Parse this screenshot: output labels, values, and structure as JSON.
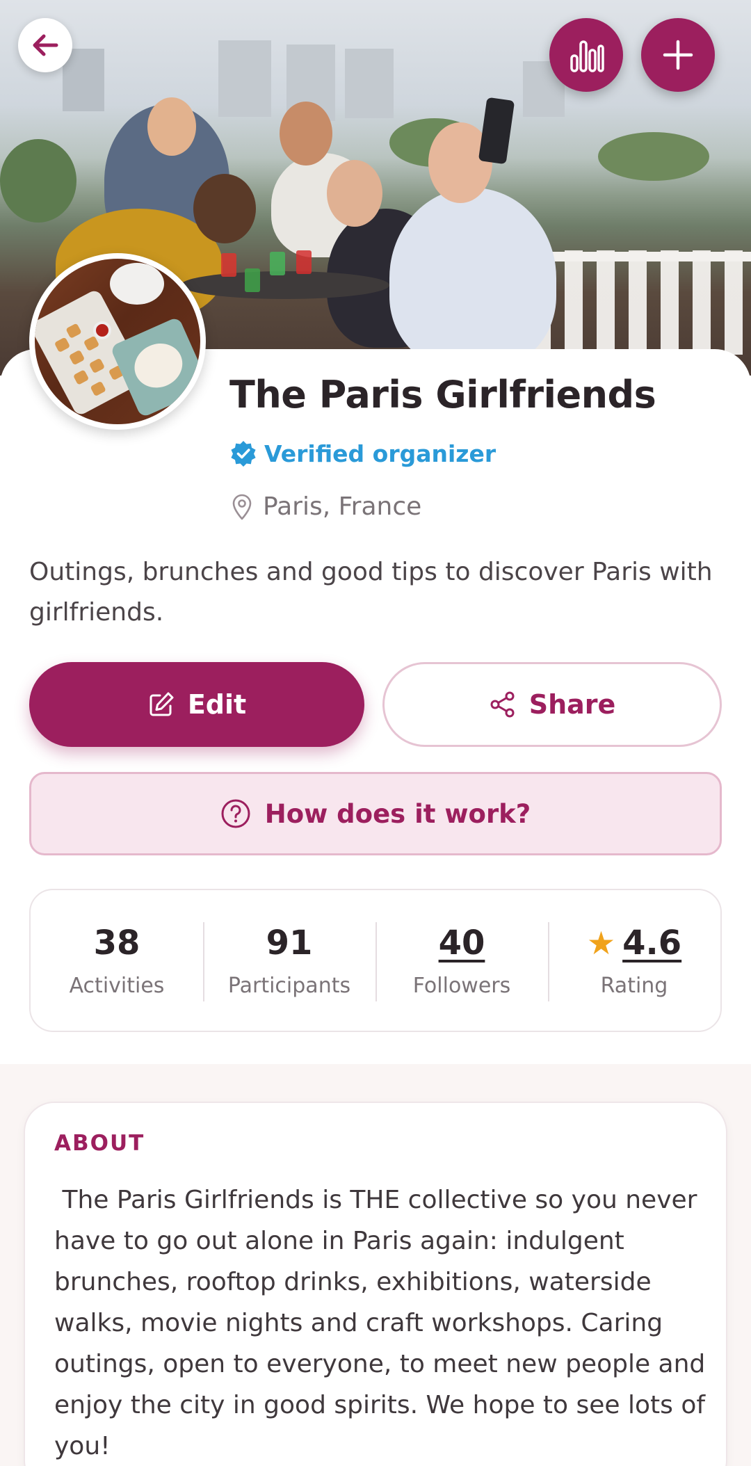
{
  "header": {
    "back_icon": "arrow-left-icon",
    "stats_icon": "bar-chart-icon",
    "add_icon": "plus-icon"
  },
  "profile": {
    "name": "The Paris Girlfriends",
    "verified_label": "Verified organizer",
    "verified_icon": "verified-badge-icon",
    "location": "Paris, France",
    "location_icon": "map-pin-icon",
    "tagline": "Outings, brunches and good tips to discover Paris with girlfriends."
  },
  "actions": {
    "edit_label": "Edit",
    "edit_icon": "edit-icon",
    "share_label": "Share",
    "share_icon": "share-icon",
    "howto_label": "How does it work?",
    "howto_icon": "help-circle-icon"
  },
  "stats": {
    "activities": {
      "value": "38",
      "label": "Activities"
    },
    "participants": {
      "value": "91",
      "label": "Participants"
    },
    "followers": {
      "value": "40",
      "label": "Followers"
    },
    "rating": {
      "value": "4.6",
      "label": "Rating",
      "icon": "star-icon"
    }
  },
  "about": {
    "title": "ABOUT",
    "text": " The Paris Girlfriends is THE collective so you never have to go out alone in Paris again: indulgent brunches, rooftop drinks, exhibitions, waterside walks, movie nights and craft workshops. Caring outings, open to everyone, to meet new people and enjoy the city in good spirits. We hope to see lots of you!"
  },
  "colors": {
    "brand": "#9c1f5e",
    "verified": "#2a9ad8",
    "star": "#f0a21b",
    "howto_bg": "#f8e6ee"
  }
}
